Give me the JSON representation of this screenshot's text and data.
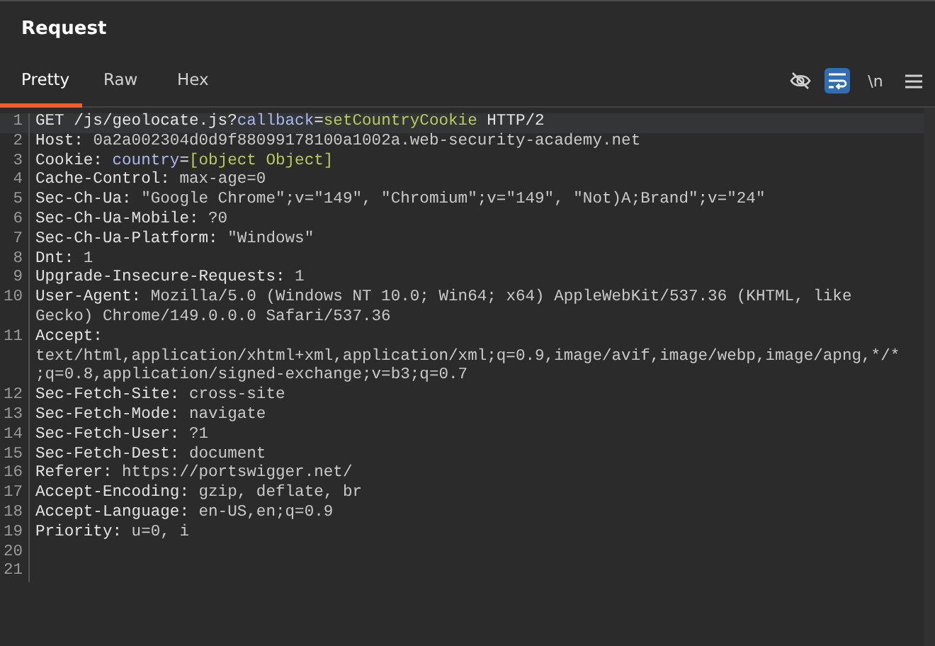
{
  "panel": {
    "title": "Request"
  },
  "tabs": [
    {
      "label": "Pretty",
      "selected": true
    },
    {
      "label": "Raw",
      "selected": false
    },
    {
      "label": "Hex",
      "selected": false
    }
  ],
  "toolbar": {
    "hide_toggle": {
      "on": false
    },
    "wrap_toggle": {
      "on": true
    },
    "newline_toggle": {
      "label": "\\n",
      "on": false
    }
  },
  "editor": {
    "lines": [
      {
        "number": "1",
        "current": true,
        "segments": [
          {
            "kind": "plain",
            "text": "GET /js/geolocate.js?"
          },
          {
            "kind": "param_name",
            "text": "callback"
          },
          {
            "kind": "plain",
            "text": "="
          },
          {
            "kind": "param_value",
            "text": "setCountryCookie"
          },
          {
            "kind": "plain",
            "text": " HTTP/2"
          }
        ]
      },
      {
        "number": "2",
        "current": false,
        "segments": [
          {
            "kind": "header_name",
            "text": "Host: "
          },
          {
            "kind": "header_value",
            "text": "0a2a002304d0d9f88099178100a1002a.web-security-academy.net"
          }
        ]
      },
      {
        "number": "3",
        "current": false,
        "segments": [
          {
            "kind": "header_name",
            "text": "Cookie: "
          },
          {
            "kind": "param_name",
            "text": "country"
          },
          {
            "kind": "plain",
            "text": "="
          },
          {
            "kind": "param_value",
            "text": "[object Object]"
          }
        ]
      },
      {
        "number": "4",
        "current": false,
        "segments": [
          {
            "kind": "header_name",
            "text": "Cache-Control: "
          },
          {
            "kind": "header_value",
            "text": "max-age=0"
          }
        ]
      },
      {
        "number": "5",
        "current": false,
        "segments": [
          {
            "kind": "header_name",
            "text": "Sec-Ch-Ua: "
          },
          {
            "kind": "header_value",
            "text": "\"Google Chrome\";v=\"149\", \"Chromium\";v=\"149\", \"Not)A;Brand\";v=\"24\""
          }
        ]
      },
      {
        "number": "6",
        "current": false,
        "segments": [
          {
            "kind": "header_name",
            "text": "Sec-Ch-Ua-Mobile: "
          },
          {
            "kind": "header_value",
            "text": "?0"
          }
        ]
      },
      {
        "number": "7",
        "current": false,
        "segments": [
          {
            "kind": "header_name",
            "text": "Sec-Ch-Ua-Platform: "
          },
          {
            "kind": "header_value",
            "text": "\"Windows\""
          }
        ]
      },
      {
        "number": "8",
        "current": false,
        "segments": [
          {
            "kind": "header_name",
            "text": "Dnt: "
          },
          {
            "kind": "header_value",
            "text": "1"
          }
        ]
      },
      {
        "number": "9",
        "current": false,
        "segments": [
          {
            "kind": "header_name",
            "text": "Upgrade-Insecure-Requests: "
          },
          {
            "kind": "header_value",
            "text": "1"
          }
        ]
      },
      {
        "number": "10",
        "current": false,
        "segments": [
          {
            "kind": "header_name",
            "text": "User-Agent: "
          },
          {
            "kind": "header_value",
            "text": "Mozilla/5.0 (Windows NT 10.0; Win64; x64) AppleWebKit/537.36 (KHTML, like Gecko) Chrome/149.0.0.0 Safari/537.36"
          }
        ]
      },
      {
        "number": "11",
        "current": false,
        "segments": [
          {
            "kind": "header_name",
            "text": "Accept: "
          },
          {
            "kind": "header_value",
            "text": "text/html,application/xhtml+xml,application/xml;q=0.9,image/avif,image/webp,image/apng,*/*;q=0.8,application/signed-exchange;v=b3;q=0.7"
          }
        ]
      },
      {
        "number": "12",
        "current": false,
        "segments": [
          {
            "kind": "header_name",
            "text": "Sec-Fetch-Site: "
          },
          {
            "kind": "header_value",
            "text": "cross-site"
          }
        ]
      },
      {
        "number": "13",
        "current": false,
        "segments": [
          {
            "kind": "header_name",
            "text": "Sec-Fetch-Mode: "
          },
          {
            "kind": "header_value",
            "text": "navigate"
          }
        ]
      },
      {
        "number": "14",
        "current": false,
        "segments": [
          {
            "kind": "header_name",
            "text": "Sec-Fetch-User: "
          },
          {
            "kind": "header_value",
            "text": "?1"
          }
        ]
      },
      {
        "number": "15",
        "current": false,
        "segments": [
          {
            "kind": "header_name",
            "text": "Sec-Fetch-Dest: "
          },
          {
            "kind": "header_value",
            "text": "document"
          }
        ]
      },
      {
        "number": "16",
        "current": false,
        "segments": [
          {
            "kind": "header_name",
            "text": "Referer: "
          },
          {
            "kind": "header_value",
            "text": "https://portswigger.net/"
          }
        ]
      },
      {
        "number": "17",
        "current": false,
        "segments": [
          {
            "kind": "header_name",
            "text": "Accept-Encoding: "
          },
          {
            "kind": "header_value",
            "text": "gzip, deflate, br"
          }
        ]
      },
      {
        "number": "18",
        "current": false,
        "segments": [
          {
            "kind": "header_name",
            "text": "Accept-Language: "
          },
          {
            "kind": "header_value",
            "text": "en-US,en;q=0.9"
          }
        ]
      },
      {
        "number": "19",
        "current": false,
        "segments": [
          {
            "kind": "header_name",
            "text": "Priority: "
          },
          {
            "kind": "header_value",
            "text": "u=0, i"
          }
        ]
      },
      {
        "number": "20",
        "current": false
      },
      {
        "number": "21",
        "current": false
      }
    ]
  }
}
